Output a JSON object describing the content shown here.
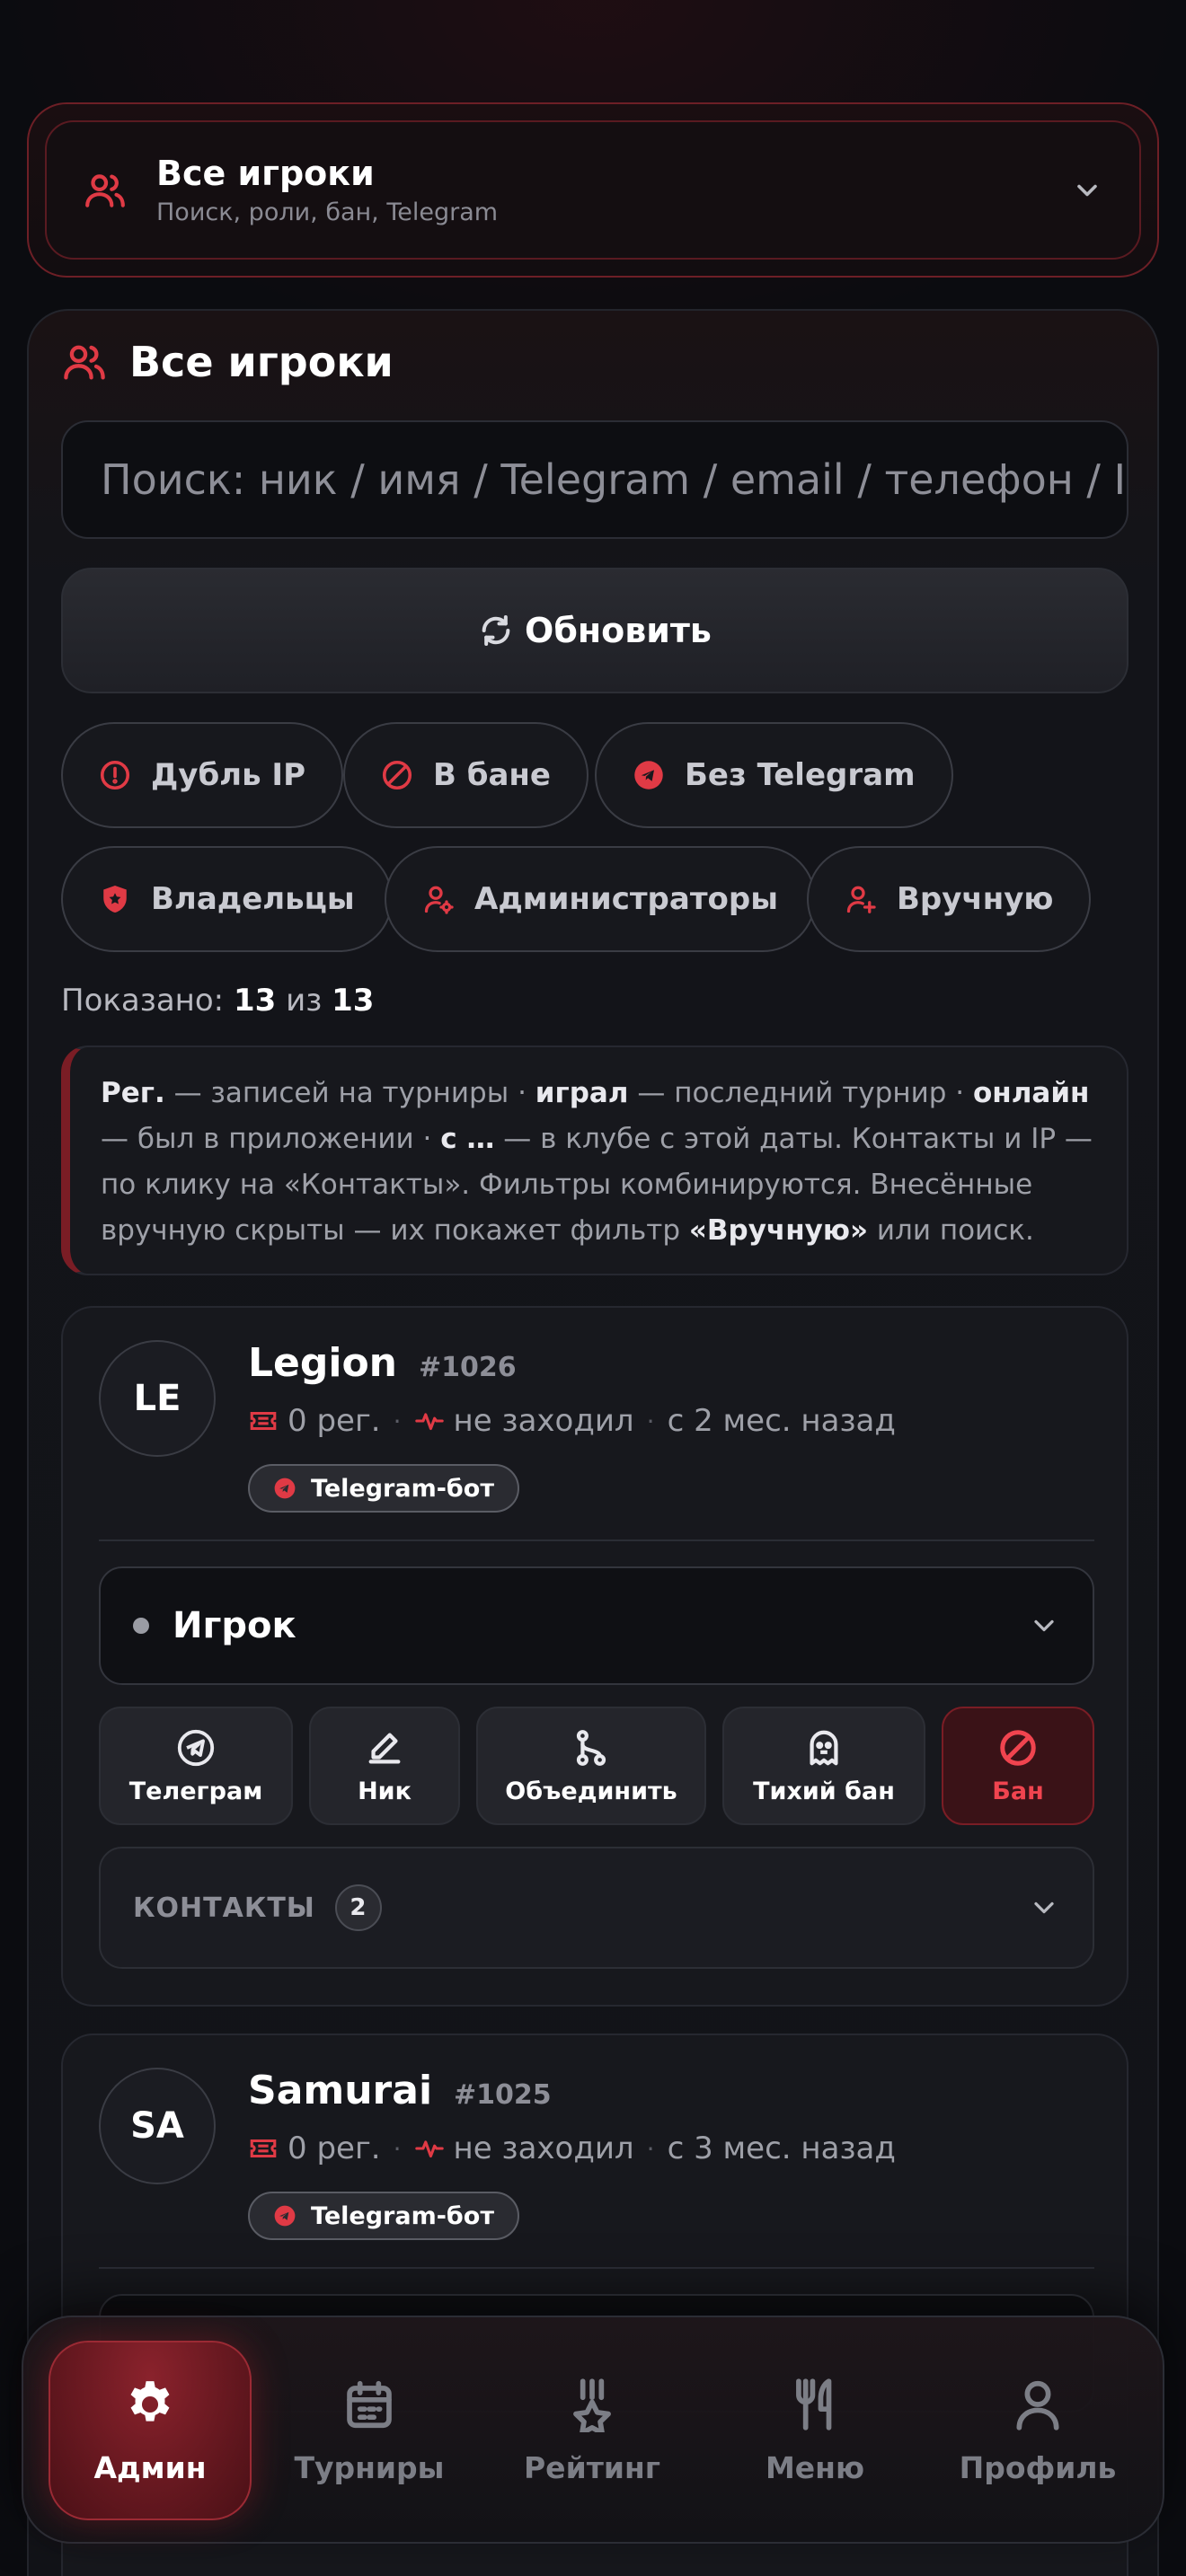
{
  "section": {
    "title": "Все игроки",
    "subtitle": "Поиск, роли, бан, Telegram"
  },
  "panel": {
    "title": "Все игроки",
    "search_placeholder": "Поиск: ник / имя / Telegram / email / телефон / IP",
    "refresh_label": "Обновить"
  },
  "filters": [
    {
      "label": "Дубль IP",
      "icon": "alert-circle-icon"
    },
    {
      "label": "В бане",
      "icon": "ban-icon"
    },
    {
      "label": "Без Telegram",
      "icon": "telegram-icon"
    },
    {
      "label": "Владельцы",
      "icon": "shield-icon"
    },
    {
      "label": "Администраторы",
      "icon": "user-gear-icon"
    },
    {
      "label": "Вручную",
      "icon": "user-plus-icon"
    }
  ],
  "shown": {
    "prefix": "Показано:",
    "count": "13",
    "sep": "из",
    "total": "13"
  },
  "hint": {
    "t1": "Рег.",
    "t2": " — записей на турниры · ",
    "t3": "играл",
    "t4": " — последний турнир · ",
    "t5": "онлайн",
    "t6": " — был в приложении · ",
    "t7": "с …",
    "t8": " — в клубе с этой даты. Контакты и IP — по клику на «Контакты». Фильтры комбинируются. Внесённые вручную скрыты — их покажет фильтр ",
    "t9": "«Вручную»",
    "t10": " или поиск."
  },
  "players": [
    {
      "initials": "LE",
      "name": "Legion",
      "id": "#1026",
      "regs": "0 рег.",
      "activity": "не заходил",
      "since": "с 2 мес. назад",
      "tag": "Telegram-бот",
      "role": "Игрок",
      "actions": {
        "telegram": "Телеграм",
        "nick": "Ник",
        "merge": "Объединить",
        "silent_ban": "Тихий бан",
        "ban": "Бан"
      },
      "contacts_label": "КОНТАКТЫ",
      "contacts_count": "2"
    },
    {
      "initials": "SA",
      "name": "Samurai",
      "id": "#1025",
      "regs": "0 рег.",
      "activity": "не заходил",
      "since": "с 3 мес. назад",
      "tag": "Telegram-бот"
    }
  ],
  "nav": [
    {
      "label": "Админ",
      "icon": "gear-icon",
      "active": true
    },
    {
      "label": "Турниры",
      "icon": "calendar-icon"
    },
    {
      "label": "Рейтинг",
      "icon": "medal-icon"
    },
    {
      "label": "Меню",
      "icon": "fork-knife-icon"
    },
    {
      "label": "Профиль",
      "icon": "user-icon"
    }
  ],
  "colors": {
    "accent": "#e03a45",
    "background": "#0b0c10",
    "card": "#17181d"
  }
}
